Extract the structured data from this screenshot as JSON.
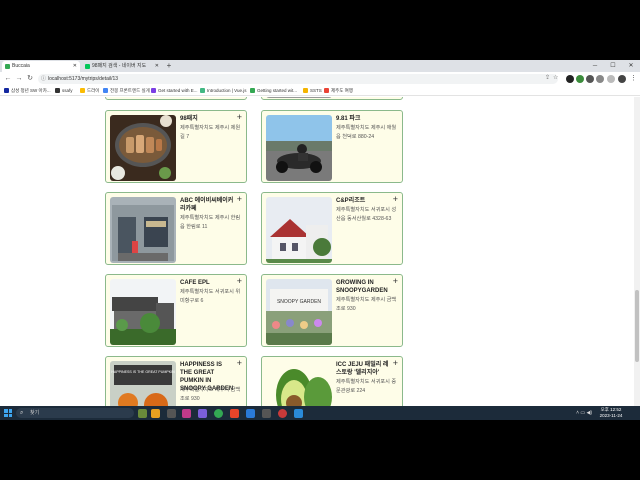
{
  "browser": {
    "tabs": [
      {
        "label": "Buccaia",
        "active": true,
        "favicon_color": "#34a853"
      },
      {
        "label": "98패지 검색 - 네이버 지도",
        "active": false,
        "favicon_color": "#03c75a"
      }
    ],
    "new_tab_glyph": "+",
    "address": "localhost:5173/mytrips/detail/13",
    "bookmarks": [
      {
        "label": "삼성 청년 SW 아카...",
        "color": "#1428a0"
      },
      {
        "label": "ssafy",
        "color": "#333333"
      },
      {
        "label": "드라이",
        "color": "#fbbc04"
      },
      {
        "label": "전봉 프론트엔드 실게",
        "color": "#4285f4"
      },
      {
        "label": "Get started with E...",
        "color": "#7b3fe4"
      },
      {
        "label": "Introduction | Vue.js",
        "color": "#42b883"
      },
      {
        "label": "Getting started wit...",
        "color": "#34a853"
      },
      {
        "label": "SSTS",
        "color": "#f4b400"
      },
      {
        "label": "제주도 여행",
        "color": "#ea4335"
      }
    ]
  },
  "places": [
    {
      "title": "98패지",
      "address": "제주특별자치도 제주시 제원길 7",
      "img": "food"
    },
    {
      "title": "9.81 파크",
      "address": "제주특별자치도 제주시 애월읍 천덕로 880-24",
      "img": "kart"
    },
    {
      "title": "ABC 에이비씨베이커리카페",
      "address": "제주특별자치도 제주시 한림읍 한림로 11",
      "img": "cafe"
    },
    {
      "title": "C&P리조트",
      "address": "제주특별자치도 서귀포시 성산읍 동서산월로 4328-63",
      "img": "resort"
    },
    {
      "title": "CAFE EPL",
      "address": "제주특별자치도 서귀포시 위미항구로 6",
      "img": "building"
    },
    {
      "title": "GROWING IN SNOOPYGARDEN",
      "address": "제주특별자치도 제주시 금백조로 930",
      "img": "snoopy"
    },
    {
      "title": "HAPPINESS IS THE GREAT PUMKIN IN SNOOPY GARDEN",
      "address": "제주특별자치도 제주시 금백조로 930",
      "img": "pumpkin"
    },
    {
      "title": "ICC JEJU 패밀리 레스토랑 '델리지아'",
      "address": "제주특별자치도 서귀포시 중문관광로 224",
      "img": "avocado"
    }
  ],
  "add_button_glyph": "+",
  "image_text": {
    "snoopy_sign": "SNOOPY GARDEN",
    "pumpkin_sign": "HAPPINESS IS THE GREAT PUMPKIN"
  },
  "taskbar": {
    "search_placeholder": "찾기",
    "time": "오후 12:52",
    "date": "2023-11-24"
  }
}
